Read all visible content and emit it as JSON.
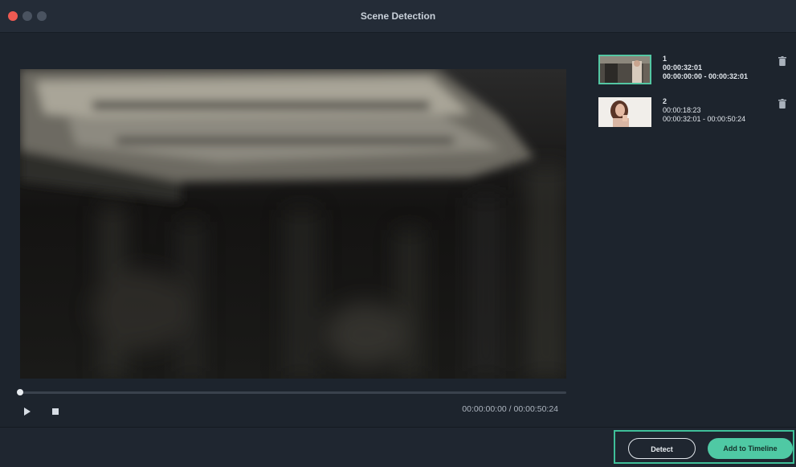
{
  "window": {
    "title": "Scene Detection"
  },
  "player": {
    "current_time": "00:00:00:00",
    "separator": " / ",
    "total_time": "00:00:50:24",
    "progress_percent": 0
  },
  "scenes": [
    {
      "index": "1",
      "duration": "00:00:32:01",
      "range": "00:00:00:00 - 00:00:32:01",
      "selected": true
    },
    {
      "index": "2",
      "duration": "00:00:18:23",
      "range": "00:00:32:01 - 00:00:50:24",
      "selected": false
    }
  ],
  "actions": {
    "detect_label": "Detect",
    "add_label": "Add to Timeline"
  },
  "colors": {
    "accent": "#4fc9a4",
    "close": "#ee5a52",
    "background": "#1d242d"
  },
  "icons": {
    "play": "play-icon",
    "stop": "stop-icon",
    "delete": "trash-icon"
  }
}
